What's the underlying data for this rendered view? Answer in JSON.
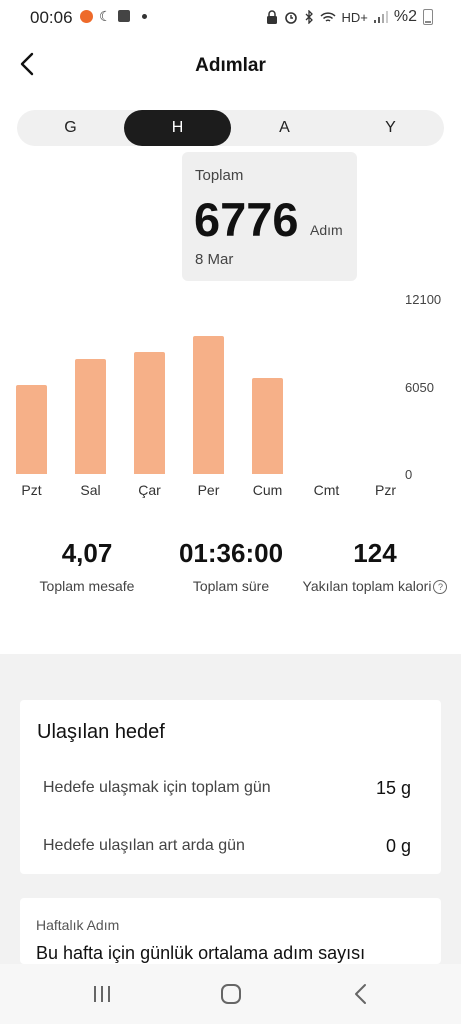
{
  "status_bar": {
    "time": "00:06",
    "network": "HD+",
    "battery": "%2",
    "icons": [
      "orange-dot-icon",
      "moon-icon",
      "box-icon",
      "lock-icon",
      "alarm-icon",
      "bluetooth-icon",
      "wifi-icon",
      "signal-icon",
      "battery-icon"
    ]
  },
  "header": {
    "title": "Adımlar",
    "back_icon": "chevron-left-icon"
  },
  "period_tabs": [
    {
      "label": "G",
      "active": false
    },
    {
      "label": "H",
      "active": true
    },
    {
      "label": "A",
      "active": false
    },
    {
      "label": "Y",
      "active": false
    }
  ],
  "tooltip": {
    "label": "Toplam",
    "value": "6776",
    "unit": "Adım",
    "date": "8 Mar"
  },
  "chart_data": {
    "type": "bar",
    "categories": [
      "Pzt",
      "Sal",
      "Çar",
      "Per",
      "Cum",
      "Cmt",
      "Pzr"
    ],
    "values": [
      6200,
      8000,
      8500,
      9600,
      6700,
      0,
      0
    ],
    "ylim": [
      0,
      12100
    ],
    "y_ticks": [
      "12100",
      "6050",
      "0"
    ],
    "bar_color": "#f6b088"
  },
  "summary": [
    {
      "value": "4,07",
      "label": "Toplam mesafe"
    },
    {
      "value": "01:36:00",
      "label": "Toplam süre"
    },
    {
      "value": "124",
      "label": "Yakılan toplam kalori",
      "info_icon": "info-circle-icon"
    }
  ],
  "goal_card": {
    "title": "Ulaşılan hedef",
    "rows": [
      {
        "label": "Hedefe ulaşmak için toplam gün",
        "value": "15 g"
      },
      {
        "label": "Hedefe ulaşılan art arda gün",
        "value": "0 g"
      }
    ]
  },
  "weekly_card": {
    "subtitle": "Haftalık Adım",
    "text": "Bu hafta için günlük ortalama adım sayısı"
  },
  "nav_bar": {
    "buttons": [
      "recent-apps-icon",
      "home-icon",
      "back-icon"
    ]
  }
}
